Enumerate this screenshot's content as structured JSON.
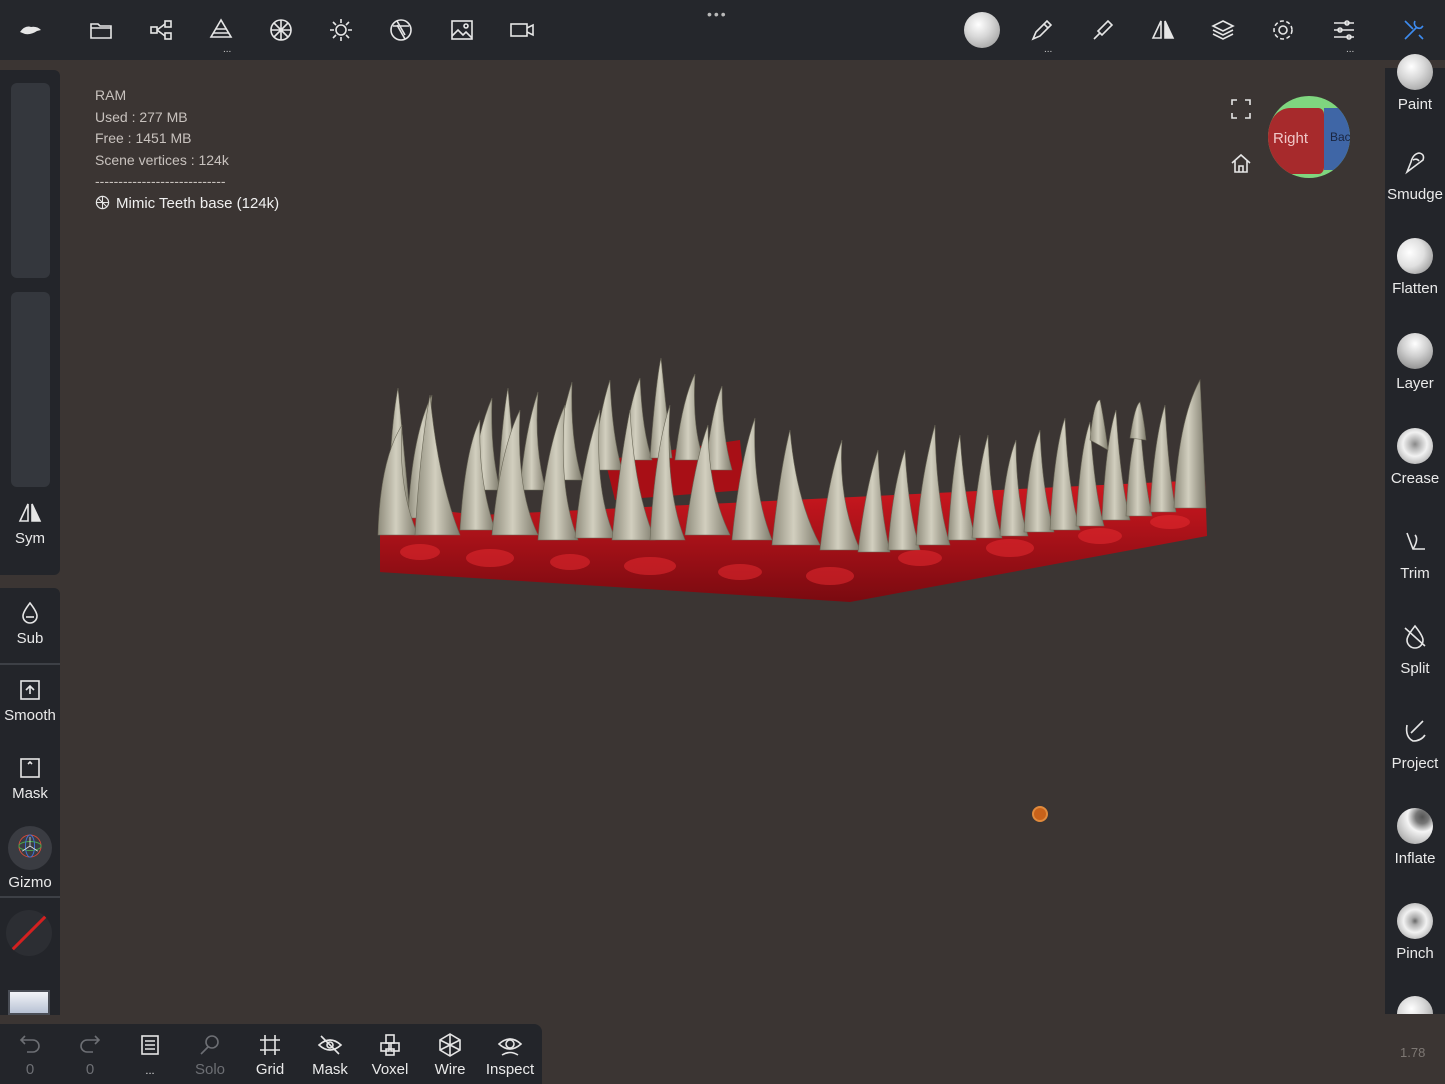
{
  "top_menu": {
    "more_dots": "•••",
    "sub_indicator": "..."
  },
  "info": {
    "ram_label": "RAM",
    "used": "Used : 277 MB",
    "free": "Free : 1451 MB",
    "scene_vertices": "Scene vertices : 124k",
    "separator": "----------------------------",
    "object_name": "Mimic Teeth base (124k)"
  },
  "viewcube": {
    "right_label": "Right",
    "back_label": "Back"
  },
  "left_panel": {
    "sym": "Sym",
    "sub": "Sub",
    "smooth": "Smooth",
    "mask": "Mask",
    "gizmo": "Gizmo"
  },
  "right_tools": [
    "Paint",
    "Smudge",
    "Flatten",
    "Layer",
    "Crease",
    "Trim",
    "Split",
    "Project",
    "Inflate",
    "Pinch"
  ],
  "bottom_bar": {
    "undo_count": "0",
    "redo_count": "0",
    "scene_dots": "...",
    "solo": "Solo",
    "grid": "Grid",
    "mask": "Mask",
    "voxel": "Voxel",
    "wire": "Wire",
    "inspect": "Inspect"
  },
  "version": "1.78",
  "colors": {
    "background": "#3b3533",
    "panel": "#23252a",
    "tooth": "#b8b5a4",
    "gum": "#b01018",
    "accent_blue": "#3d8bf0"
  }
}
